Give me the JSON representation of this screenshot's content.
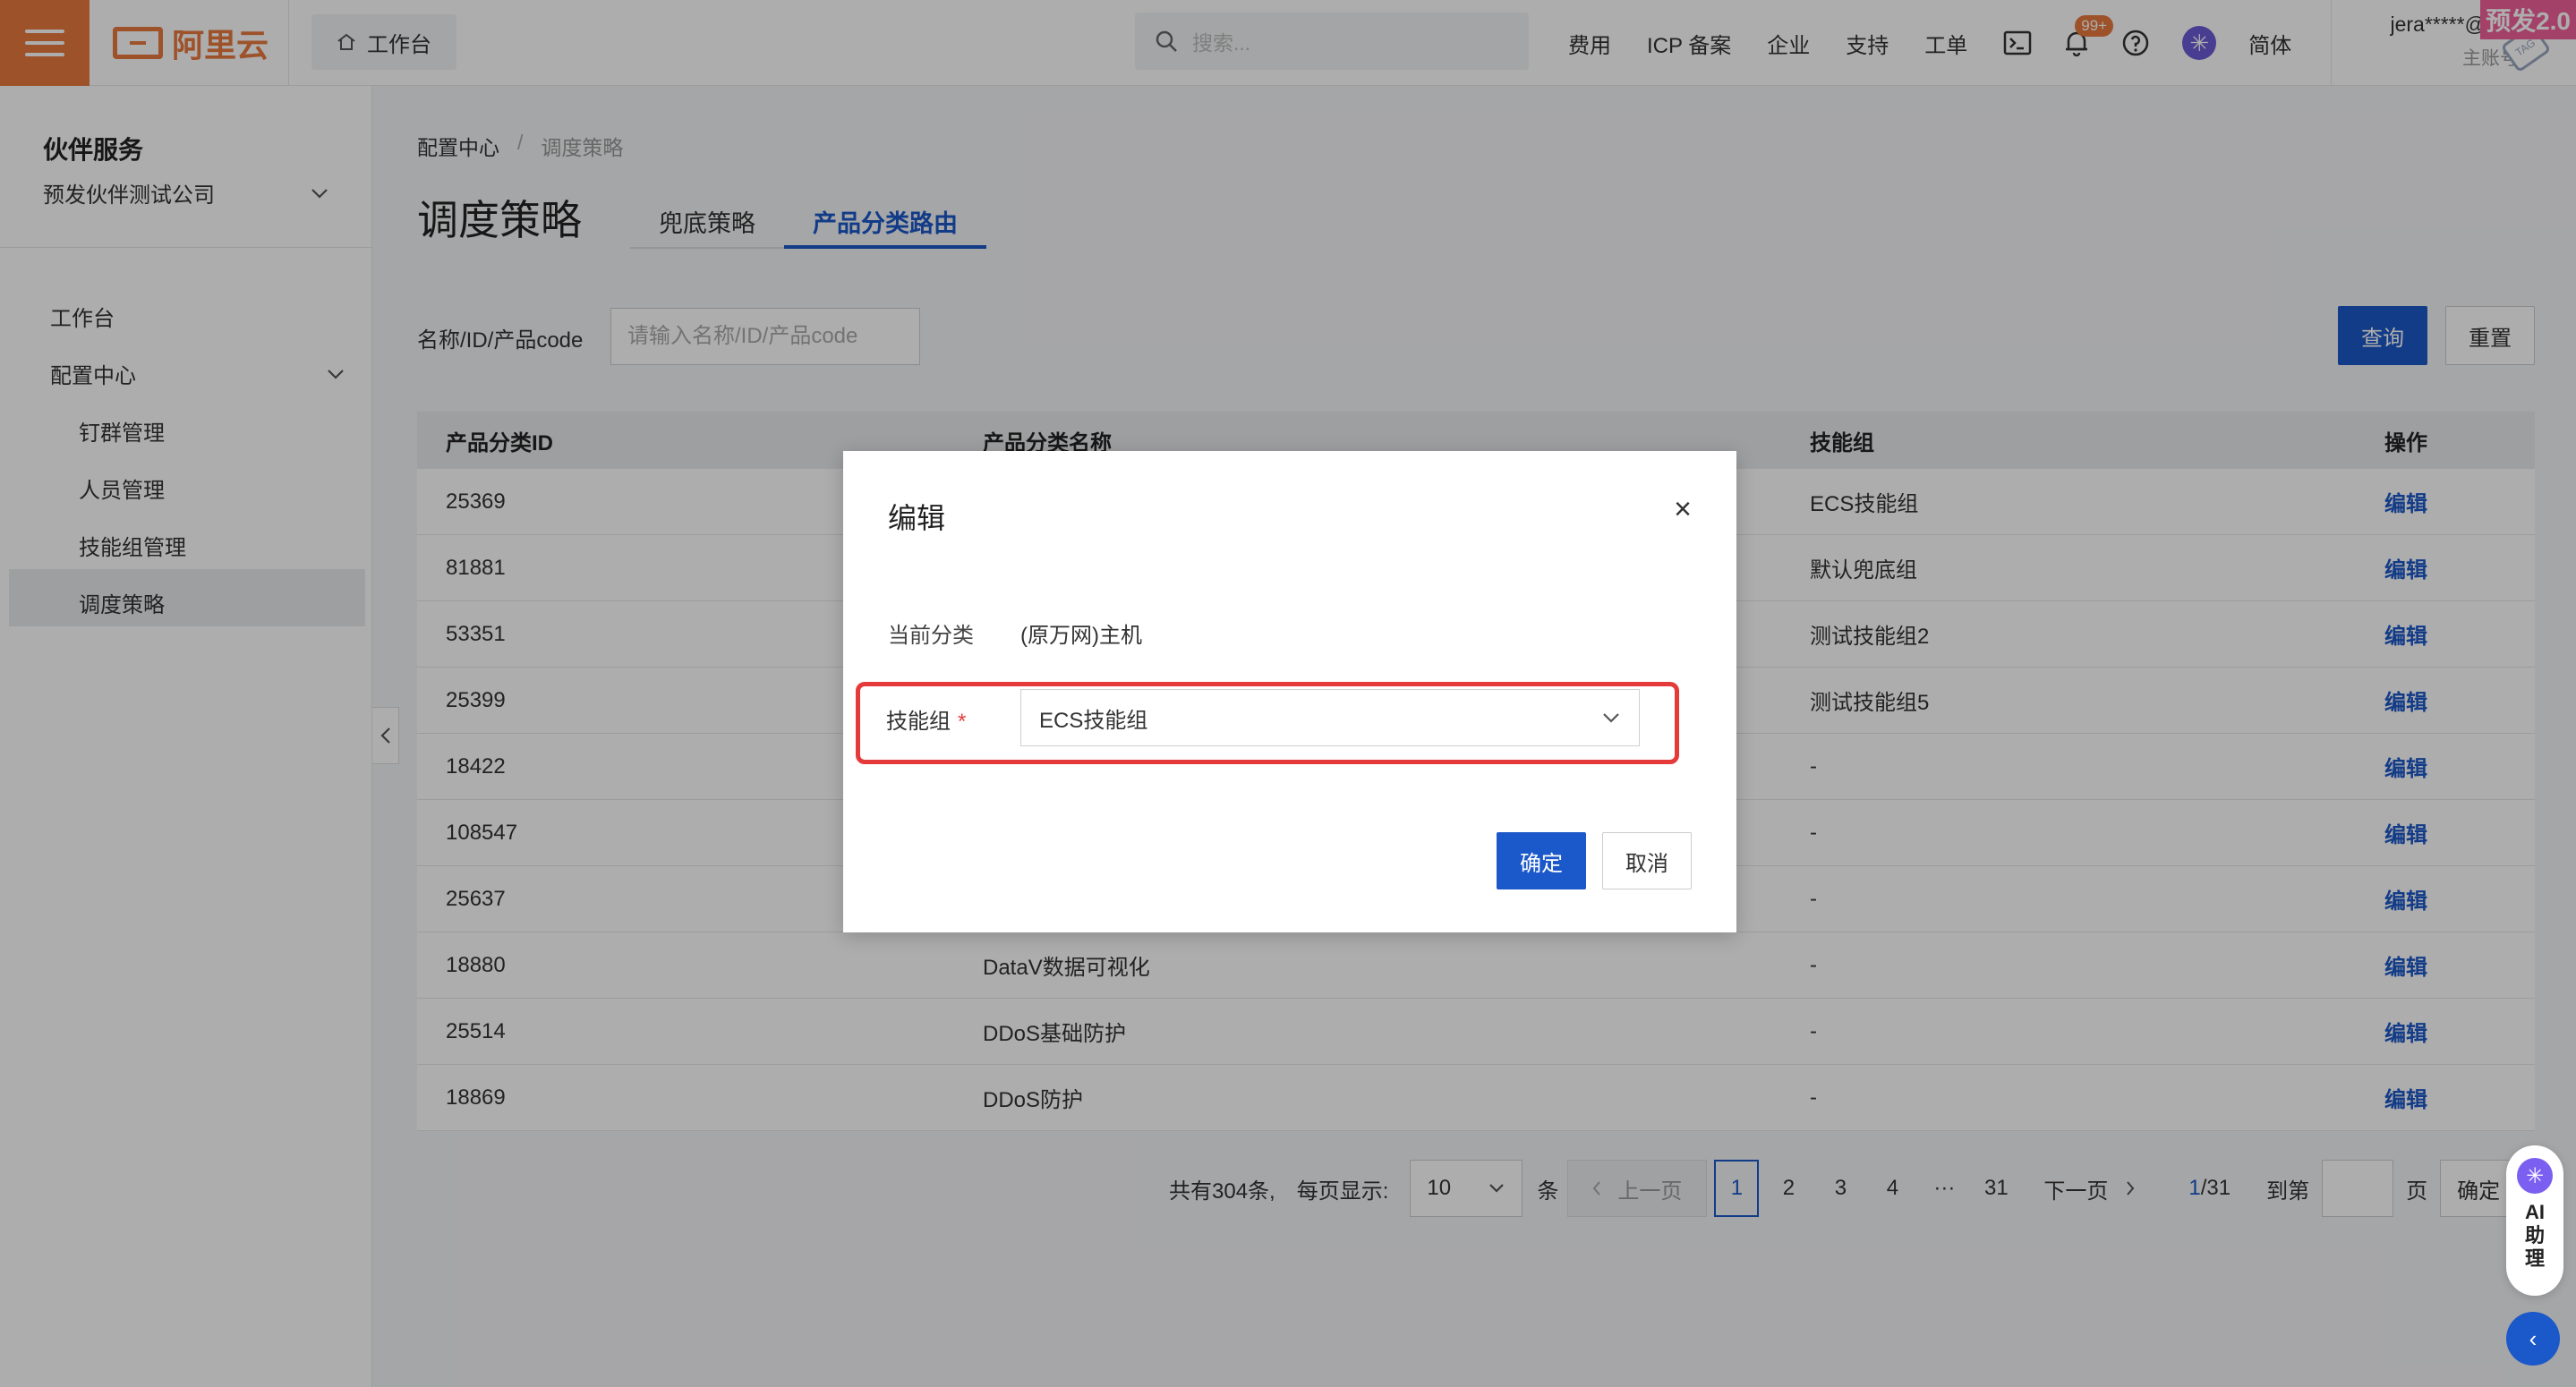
{
  "topbar": {
    "brand": "阿里云",
    "workbench": "工作台",
    "search_placeholder": "搜索...",
    "nav": [
      "费用",
      "ICP 备案",
      "企业",
      "支持",
      "工单"
    ],
    "notification_badge": "99+",
    "language": "简体",
    "account_name": "jera*****@al...",
    "account_role": "主账号",
    "env_tag": "预发2.0",
    "accent_color": "#e8793f"
  },
  "sidebar": {
    "title": "伙伴服务",
    "company": "预发伙伴测试公司",
    "items": [
      {
        "label": "工作台"
      },
      {
        "label": "配置中心"
      },
      {
        "label": "钉群管理"
      },
      {
        "label": "人员管理"
      },
      {
        "label": "技能组管理"
      },
      {
        "label": "调度策略"
      }
    ]
  },
  "breadcrumb": {
    "parent": "配置中心",
    "separator": "/",
    "current": "调度策略"
  },
  "page": {
    "title": "调度策略",
    "tabs": [
      {
        "label": "兜底策略"
      },
      {
        "label": "产品分类路由"
      }
    ]
  },
  "filter": {
    "label": "名称/ID/产品code",
    "placeholder": "请输入名称/ID/产品code",
    "query_label": "查询",
    "reset_label": "重置"
  },
  "table": {
    "headers": [
      "产品分类ID",
      "产品分类名称",
      "技能组",
      "操作"
    ],
    "rows": [
      {
        "id": "25369",
        "name": "",
        "group": "ECS技能组",
        "op": "编辑"
      },
      {
        "id": "81881",
        "name": "",
        "group": "默认兜底组",
        "op": "编辑"
      },
      {
        "id": "53351",
        "name": "",
        "group": "测试技能组2",
        "op": "编辑"
      },
      {
        "id": "25399",
        "name": "",
        "group": "测试技能组5",
        "op": "编辑"
      },
      {
        "id": "18422",
        "name": "",
        "group": "-",
        "op": "编辑"
      },
      {
        "id": "108547",
        "name": "",
        "group": "-",
        "op": "编辑"
      },
      {
        "id": "25637",
        "name": "",
        "group": "-",
        "op": "编辑"
      },
      {
        "id": "18880",
        "name": "DataV数据可视化",
        "group": "-",
        "op": "编辑"
      },
      {
        "id": "25514",
        "name": "DDoS基础防护",
        "group": "-",
        "op": "编辑"
      },
      {
        "id": "18869",
        "name": "DDoS防护",
        "group": "-",
        "op": "编辑"
      }
    ]
  },
  "pagination": {
    "total": "共有304条,",
    "per_page_label": "每页显示:",
    "per_page": "10",
    "unit": "条",
    "prev": "上一页",
    "pages": [
      "1",
      "2",
      "3",
      "4",
      "···",
      "31"
    ],
    "next": "下一页",
    "current": "1",
    "total_pages": "/31",
    "goto_label": "到第",
    "page_unit": "页",
    "confirm": "确定"
  },
  "modal": {
    "title": "编辑",
    "current_label": "当前分类",
    "current_value": "(原万网)主机",
    "group_label": "技能组",
    "required_mark": "*",
    "group_value": "ECS技能组",
    "ok": "确定",
    "cancel": "取消"
  },
  "ai": {
    "label": "AI助理"
  }
}
